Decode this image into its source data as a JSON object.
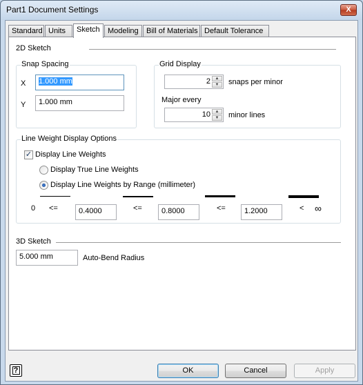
{
  "window": {
    "title": "Part1 Document Settings",
    "close_glyph": "X"
  },
  "tabs": [
    {
      "label": "Standard",
      "active": false
    },
    {
      "label": "Units",
      "active": false
    },
    {
      "label": "Sketch",
      "active": true
    },
    {
      "label": "Modeling",
      "active": false
    },
    {
      "label": "Bill of Materials",
      "active": false
    },
    {
      "label": "Default Tolerance",
      "active": false
    }
  ],
  "sketch2d": {
    "title": "2D Sketch",
    "snap_spacing": {
      "label": "Snap Spacing",
      "x_label": "X",
      "x_value": "1.000 mm",
      "y_label": "Y",
      "y_value": "1.000 mm"
    },
    "grid_display": {
      "label": "Grid Display",
      "snaps_value": "2",
      "snaps_label": "snaps per minor",
      "major_every_label": "Major every",
      "major_value": "10",
      "minor_lines_label": "minor lines"
    },
    "line_weight": {
      "label": "Line Weight Display Options",
      "display_checkbox_label": "Display Line Weights",
      "display_checked": true,
      "true_weights_label": "Display True Line Weights",
      "by_range_label": "Display Line Weights by Range (millimeter)",
      "range_selected": "by_range",
      "zero": "0",
      "le_1": "<=",
      "value_1": "0.4000",
      "le_2": "<=",
      "value_2": "0.8000",
      "le_3": "<=",
      "value_3": "1.2000",
      "lt": "<",
      "infinity": "∞"
    }
  },
  "sketch3d": {
    "title": "3D Sketch",
    "auto_bend_value": "5.000 mm",
    "auto_bend_label": "Auto-Bend Radius"
  },
  "footer": {
    "help_glyph": "?",
    "ok_label": "OK",
    "cancel_label": "Cancel",
    "apply_label": "Apply",
    "apply_enabled": false
  },
  "colors": {
    "frame": "#c5d7ea",
    "selection": "#3399ff",
    "close_button": "#c9583d"
  },
  "icons": {
    "close": "close-icon",
    "help": "help-icon",
    "spin_up": "spin-up-icon",
    "spin_down": "spin-down-icon"
  }
}
